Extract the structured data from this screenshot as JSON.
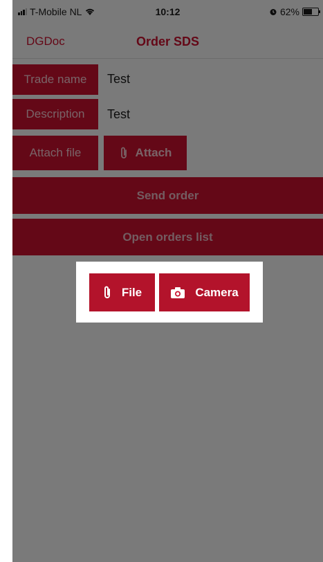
{
  "colors": {
    "accent": "#c8102e",
    "accent_dark": "#b3132b",
    "overlay": "#808080",
    "popup_bg": "#ffffff"
  },
  "status_bar": {
    "carrier": "T-Mobile NL",
    "time": "10:12",
    "battery": "62%",
    "battery_level": 0.62
  },
  "nav": {
    "back_label": "DGDoc",
    "title": "Order SDS"
  },
  "form": {
    "trade_name_label": "Trade name",
    "trade_name_value": "Test",
    "description_label": "Description",
    "description_value": "Test",
    "attach_file_label": "Attach file",
    "attach_button_label": "Attach"
  },
  "actions": {
    "send_order_label": "Send order",
    "open_orders_label": "Open orders list"
  },
  "popup": {
    "file_label": "File",
    "camera_label": "Camera"
  },
  "icons": {
    "wifi": "wifi-icon",
    "alarm": "alarm-icon",
    "paperclip": "paperclip-icon",
    "camera": "camera-icon"
  }
}
